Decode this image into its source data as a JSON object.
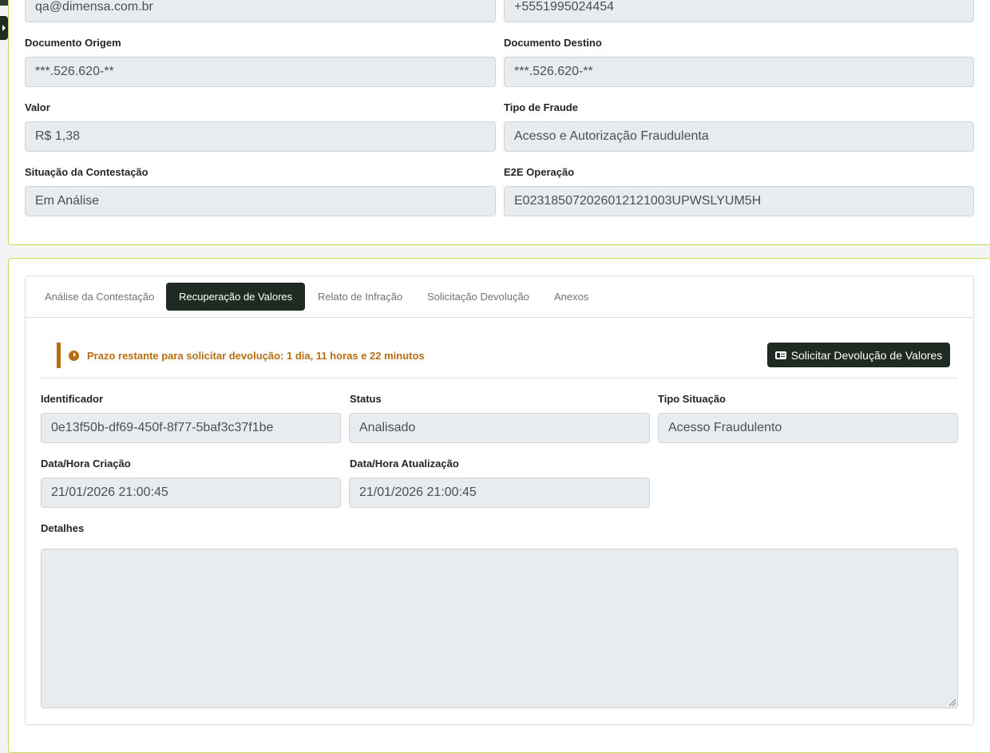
{
  "top_card": {
    "email_value": "qa@dimensa.com.br",
    "phone_value": "+5551995024454",
    "documento_origem": {
      "label": "Documento Origem",
      "value": "***.526.620-**"
    },
    "documento_destino": {
      "label": "Documento Destino",
      "value": "***.526.620-**"
    },
    "valor": {
      "label": "Valor",
      "value": "R$ 1,38"
    },
    "tipo_fraude": {
      "label": "Tipo de Fraude",
      "value": "Acesso e Autorização Fraudulenta"
    },
    "situacao": {
      "label": "Situação da Contestação",
      "value": "Em Análise"
    },
    "e2e": {
      "label": "E2E Operação",
      "value": "E02318507202601212100​3UPWSLYUM5H"
    }
  },
  "tabs": [
    {
      "label": "Análise da Contestação",
      "active": false
    },
    {
      "label": "Recuperação de Valores",
      "active": true
    },
    {
      "label": "Relato de Infração",
      "active": false
    },
    {
      "label": "Solicitação Devolução",
      "active": false
    },
    {
      "label": "Anexos",
      "active": false
    }
  ],
  "recovery": {
    "alert_text": "Prazo restante para solicitar devolução: 1 dia, 11 horas e 22 minutos",
    "request_button": "Solicitar Devolução de Valores",
    "identificador": {
      "label": "Identificador",
      "value": "0e13f50b-df69-450f-8f77-5baf3c37f1be"
    },
    "status": {
      "label": "Status",
      "value": "Analisado"
    },
    "tipo_situacao": {
      "label": "Tipo Situação",
      "value": "Acesso Fraudulento"
    },
    "criacao": {
      "label": "Data/Hora Criação",
      "value": "21/01/2026 21:00:45"
    },
    "atualizacao": {
      "label": "Data/Hora Atualização",
      "value": "21/01/2026 21:00:45"
    },
    "detalhes": {
      "label": "Detalhes",
      "value": ""
    }
  },
  "colors": {
    "accent_dark": "#1f2b22",
    "warning": "#b86e12",
    "card_border": "#c5dc4f"
  }
}
